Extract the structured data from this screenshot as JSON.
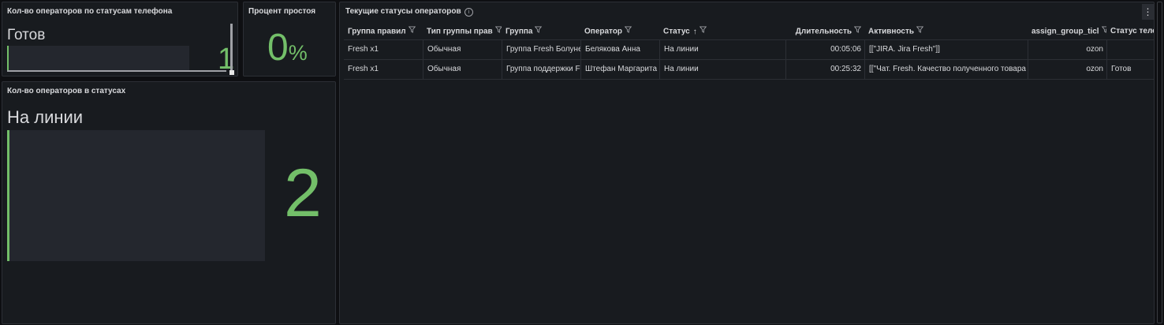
{
  "panels": {
    "phone_status": {
      "title": "Кол-во операторов по статусам телефона",
      "label": "Готов",
      "value": "1"
    },
    "idle": {
      "title": "Процент простоя",
      "value": "0",
      "unit": "%"
    },
    "operator_status": {
      "title": "Кол-во операторов в статусах",
      "label": "На линии",
      "value": "2"
    },
    "table": {
      "title": "Текущие статусы операторов",
      "info_icon": "i",
      "menu_icon": "⋮"
    }
  },
  "table": {
    "headers": [
      "Группа правил",
      "Тип группы прав",
      "Группа",
      "Оператор",
      "Статус",
      "Длительность",
      "Активность",
      "assign_group_ticl",
      "Статус теле"
    ],
    "sort_icon": "↑",
    "rows": [
      [
        "Fresh x1",
        "Обычная",
        "Группа Fresh Болуне",
        "Белякова Анна",
        "На линии",
        "00:05:06",
        "[[\"JIRA. Jira Fresh\"]]",
        "ozon",
        ""
      ],
      [
        "Fresh x1",
        "Обычная",
        "Группа поддержки F",
        "Штефан Маргарита",
        "На линии",
        "00:25:32",
        "[[\"Чат. Fresh. Качество полученного товара",
        "ozon",
        "Готов"
      ]
    ]
  },
  "colors": {
    "accent_green": "#73bf69",
    "panel_bg": "#181b1f",
    "page_bg": "#0e0f12"
  }
}
